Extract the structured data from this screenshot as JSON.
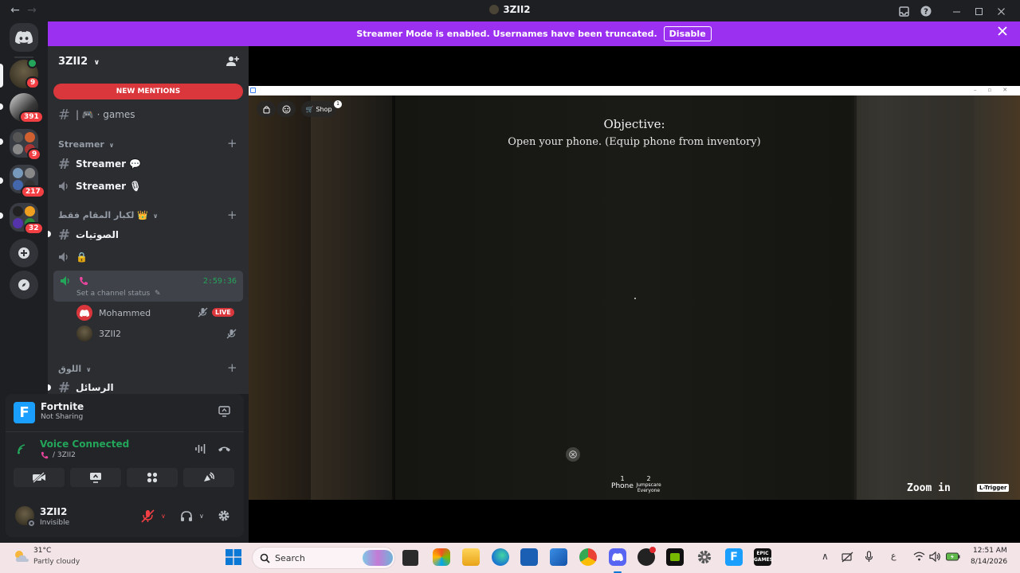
{
  "window": {
    "title": "3ZII2",
    "back": "←",
    "forward": "→"
  },
  "banner": {
    "text": "Streamer Mode is enabled. Usernames have been truncated.",
    "button": "Disable"
  },
  "rail": {
    "servers": [
      {
        "badge": "9"
      },
      {
        "badge": "391"
      },
      {
        "badge": "9"
      },
      {
        "badge": "217"
      },
      {
        "badge": "32"
      }
    ]
  },
  "sidebar": {
    "server_name": "3ZII2",
    "new_mentions": "NEW MENTIONS",
    "channels": {
      "games": "| 🎮 · games",
      "cat_streamer": "Streamer",
      "streamer_text": "Streamer 💬",
      "streamer_voice": "Streamer 🎙",
      "cat_arabic": "لكبار المقام فقط 👑",
      "soutiyat": "الصوتيات",
      "locked": "🔒",
      "cat_loq": "اللوق",
      "rasael": "الرسائل"
    },
    "active_voice": {
      "timer": "2:59:36",
      "set_status": "Set a channel status"
    },
    "voice_users": [
      {
        "name": "Mohammed",
        "live": "LIVE"
      },
      {
        "name": "3ZII2"
      }
    ]
  },
  "panel": {
    "game_name": "Fortnite",
    "game_status": "Not Sharing",
    "voice_title": "Voice Connected",
    "voice_sub": "/ 3ZII2",
    "user_name": "3ZII2",
    "user_status": "Invisible"
  },
  "game": {
    "hud_shop": "Shop",
    "hud_badge": "1",
    "objective_title": "Objective:",
    "objective_text": "Open your phone. (Equip phone from inventory)",
    "hotbar": [
      {
        "key": "1",
        "label": "Phone"
      },
      {
        "key": "2",
        "label": "Jumpscare Everyone"
      }
    ],
    "zoom": "Zoom in",
    "trigger": "L-Trigger"
  },
  "taskbar": {
    "weather_temp": "31°C",
    "weather_desc": "Partly cloudy",
    "search": "Search",
    "time": "12:51 AM",
    "date": "8/14/2026",
    "ime": "ع"
  },
  "colors": {
    "banner": "#9b30f0",
    "mention": "#da373c",
    "green": "#23a55a",
    "sidebar": "#2b2d31",
    "rail": "#1e1f22"
  }
}
